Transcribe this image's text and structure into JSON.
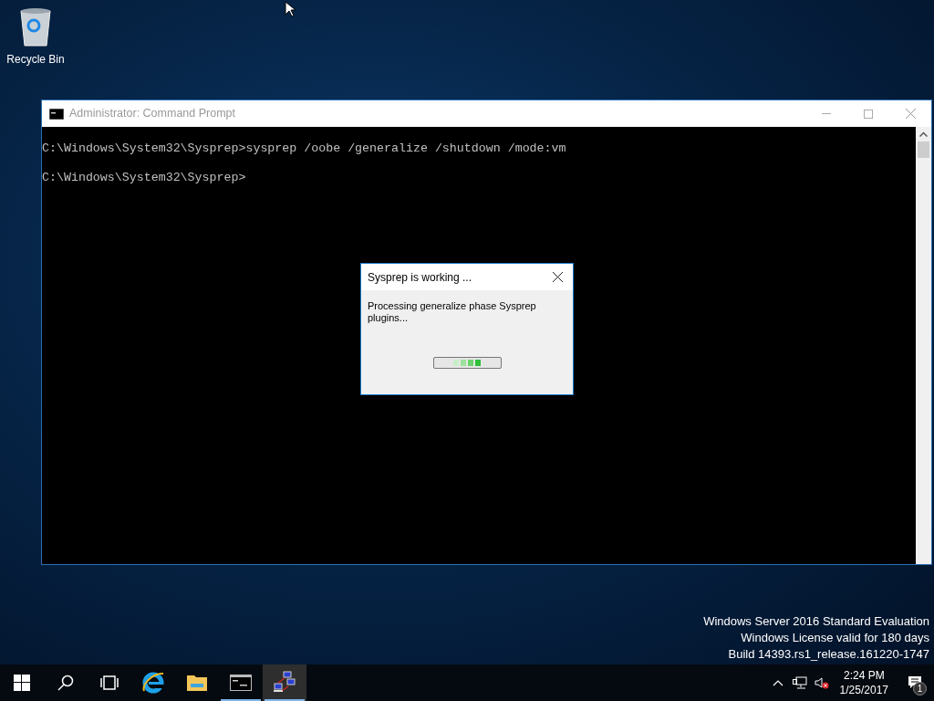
{
  "desktop": {
    "icons": [
      {
        "label": "Recycle Bin"
      }
    ],
    "watermark_lines": [
      "Windows Server 2016 Standard Evaluation",
      "Windows License valid for 180 days",
      "Build 14393.rs1_release.161220-1747"
    ]
  },
  "console_window": {
    "title": "Administrator: Command Prompt",
    "lines": [
      "C:\\Windows\\System32\\Sysprep>sysprep /oobe /generalize /shutdown /mode:vm",
      "C:\\Windows\\System32\\Sysprep>"
    ]
  },
  "dialog": {
    "title": "Sysprep is working ...",
    "message": "Processing generalize phase Sysprep plugins..."
  },
  "taskbar": {
    "items": [
      {
        "kind": "start",
        "running": false,
        "selected": false
      },
      {
        "kind": "search",
        "running": false,
        "selected": false
      },
      {
        "kind": "taskview",
        "running": false,
        "selected": false
      },
      {
        "kind": "browser",
        "running": false,
        "selected": false
      },
      {
        "kind": "folder",
        "running": false,
        "selected": false
      },
      {
        "kind": "console",
        "running": true,
        "selected": false
      },
      {
        "kind": "network",
        "running": true,
        "selected": true
      }
    ],
    "time": "2:24 PM",
    "date": "1/25/2017",
    "notification_count": "1"
  }
}
